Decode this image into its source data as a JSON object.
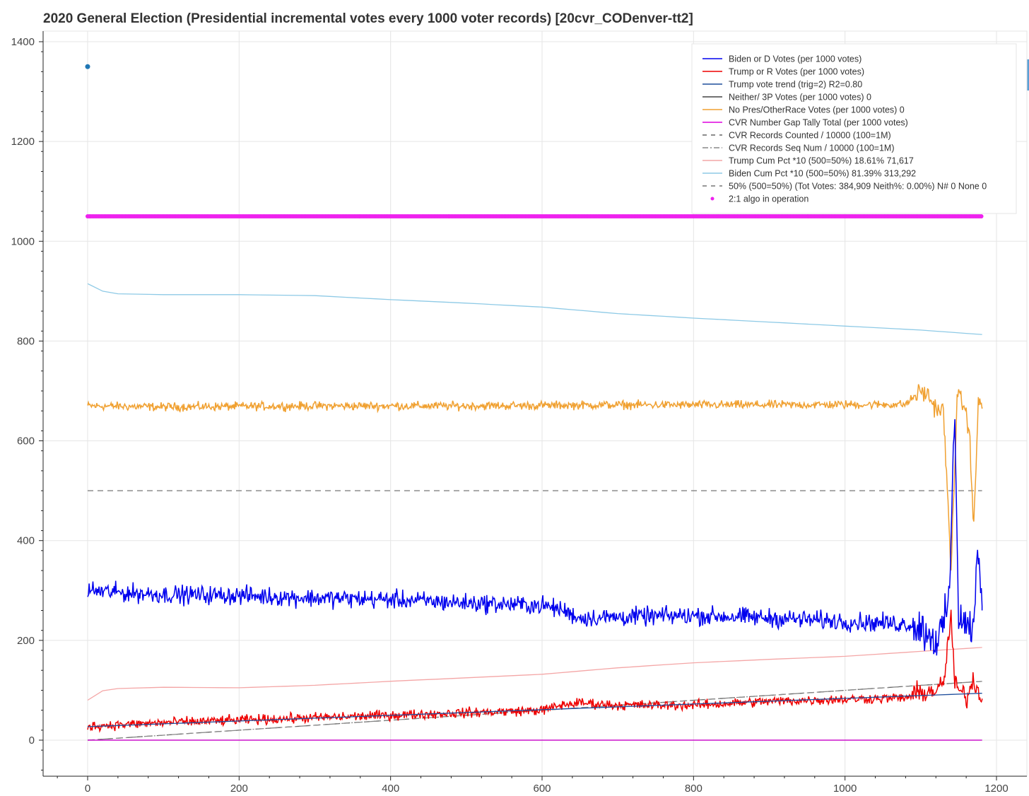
{
  "chart_data": {
    "type": "line",
    "title": "2020 General Election (Presidential incremental votes every 1000 voter records) [20cvr_CODenver-tt2]",
    "xlabel": "",
    "ylabel": "",
    "xlim": [
      -100,
      1215
    ],
    "ylim": [
      -80,
      1415
    ],
    "x_ticks": [
      0,
      200,
      400,
      600,
      800,
      1000,
      1200
    ],
    "y_ticks": [
      0,
      200,
      400,
      600,
      800,
      1000,
      1200,
      1400
    ],
    "grid": true,
    "legend_position": "top-right",
    "n_points": 1182,
    "series": [
      {
        "name": "Biden or D Votes (per 1000 votes)",
        "color": "#0000ee",
        "style": "solid",
        "anchors": [
          [
            0,
            300
          ],
          [
            50,
            295
          ],
          [
            100,
            292
          ],
          [
            200,
            290
          ],
          [
            300,
            285
          ],
          [
            400,
            282
          ],
          [
            500,
            275
          ],
          [
            600,
            270
          ],
          [
            625,
            262
          ],
          [
            650,
            245
          ],
          [
            800,
            250
          ],
          [
            900,
            245
          ],
          [
            1000,
            238
          ],
          [
            1090,
            232
          ],
          [
            1100,
            225
          ],
          [
            1110,
            215
          ],
          [
            1120,
            200
          ],
          [
            1130,
            225
          ],
          [
            1138,
            300
          ],
          [
            1145,
            660
          ],
          [
            1150,
            250
          ],
          [
            1160,
            230
          ],
          [
            1170,
            225
          ],
          [
            1175,
            380
          ],
          [
            1182,
            240
          ]
        ],
        "noise": 13
      },
      {
        "name": "Trump or R Votes (per 1000 votes)",
        "color": "#ee0000",
        "style": "solid",
        "anchors": [
          [
            0,
            28
          ],
          [
            100,
            35
          ],
          [
            200,
            40
          ],
          [
            300,
            45
          ],
          [
            400,
            50
          ],
          [
            500,
            55
          ],
          [
            600,
            60
          ],
          [
            625,
            70
          ],
          [
            650,
            75
          ],
          [
            700,
            70
          ],
          [
            800,
            70
          ],
          [
            900,
            78
          ],
          [
            1000,
            82
          ],
          [
            1080,
            85
          ],
          [
            1100,
            95
          ],
          [
            1120,
            100
          ],
          [
            1130,
            110
          ],
          [
            1140,
            250
          ],
          [
            1145,
            110
          ],
          [
            1160,
            85
          ],
          [
            1170,
            120
          ],
          [
            1182,
            80
          ]
        ],
        "noise": 7
      },
      {
        "name": "Trump vote trend (trig=2) R2=0.80",
        "color": "#1f4e9c",
        "style": "solid",
        "anchors": [
          [
            0,
            27
          ],
          [
            1182,
            94
          ]
        ],
        "noise": 0
      },
      {
        "name": "Neither/ 3P Votes (per 1000 votes) 0",
        "color": "#444444",
        "style": "solid",
        "anchors": [
          [
            0,
            0
          ],
          [
            1182,
            0
          ]
        ],
        "noise": 0
      },
      {
        "name": "No Pres/OtherRace Votes (per 1000 votes) 0",
        "color": "#f0a030",
        "style": "solid",
        "anchors": [
          [
            0,
            670
          ],
          [
            100,
            668
          ],
          [
            300,
            670
          ],
          [
            500,
            670
          ],
          [
            700,
            672
          ],
          [
            900,
            672
          ],
          [
            1080,
            673
          ],
          [
            1100,
            700
          ],
          [
            1110,
            690
          ],
          [
            1120,
            665
          ],
          [
            1130,
            660
          ],
          [
            1140,
            340
          ],
          [
            1148,
            690
          ],
          [
            1158,
            670
          ],
          [
            1165,
            600
          ],
          [
            1170,
            420
          ],
          [
            1176,
            680
          ],
          [
            1182,
            665
          ]
        ],
        "noise": 6
      },
      {
        "name": "CVR Number Gap Tally Total (per 1000 votes)",
        "color": "#dd00dd",
        "style": "solid",
        "anchors": [
          [
            0,
            0
          ],
          [
            1182,
            0
          ]
        ],
        "noise": 0
      },
      {
        "name": "CVR Records Counted / 10000 (100=1M)",
        "color": "#666666",
        "style": "dashed",
        "anchors": [
          [
            0,
            0
          ],
          [
            1182,
            118
          ]
        ],
        "noise": 0
      },
      {
        "name": "CVR Records Seq Num / 10000 (100=1M)",
        "color": "#888888",
        "style": "dashdot",
        "anchors": [
          [
            0,
            0
          ],
          [
            1182,
            118
          ]
        ],
        "noise": 0
      },
      {
        "name": "Trump Cum Pct *10 (500=50%) 18.61% 71,617",
        "color": "#f4a6a6",
        "style": "solid",
        "anchors": [
          [
            0,
            80
          ],
          [
            10,
            95
          ],
          [
            30,
            103
          ],
          [
            100,
            106
          ],
          [
            200,
            105
          ],
          [
            300,
            110
          ],
          [
            400,
            118
          ],
          [
            500,
            125
          ],
          [
            600,
            132
          ],
          [
            700,
            145
          ],
          [
            800,
            155
          ],
          [
            900,
            162
          ],
          [
            1000,
            168
          ],
          [
            1100,
            178
          ],
          [
            1182,
            186
          ]
        ],
        "noise": 0
      },
      {
        "name": "Biden Cum Pct *10 (500=50%) 81.39% 313,292",
        "color": "#8ecae6",
        "style": "solid",
        "anchors": [
          [
            0,
            915
          ],
          [
            3,
            922
          ],
          [
            10,
            905
          ],
          [
            30,
            895
          ],
          [
            100,
            893
          ],
          [
            200,
            893
          ],
          [
            300,
            891
          ],
          [
            400,
            883
          ],
          [
            500,
            876
          ],
          [
            600,
            868
          ],
          [
            700,
            855
          ],
          [
            800,
            846
          ],
          [
            900,
            838
          ],
          [
            1000,
            830
          ],
          [
            1100,
            822
          ],
          [
            1182,
            813
          ]
        ],
        "noise": 0
      },
      {
        "name": "50% (500=50%) (Tot Votes: 384,909 Neith%: 0.00%) N# 0 None 0",
        "color": "#777777",
        "style": "dashed",
        "anchors": [
          [
            0,
            500
          ],
          [
            1182,
            500
          ]
        ],
        "noise": 0
      },
      {
        "name": "2:1 algo in operation",
        "color": "#ee22ee",
        "style": "dots",
        "anchors": [
          [
            0,
            1050
          ],
          [
            1182,
            1050
          ]
        ],
        "noise": 0
      }
    ],
    "extra_points": [
      {
        "x": 0,
        "y": 1350,
        "color": "#1f77b4"
      }
    ]
  }
}
